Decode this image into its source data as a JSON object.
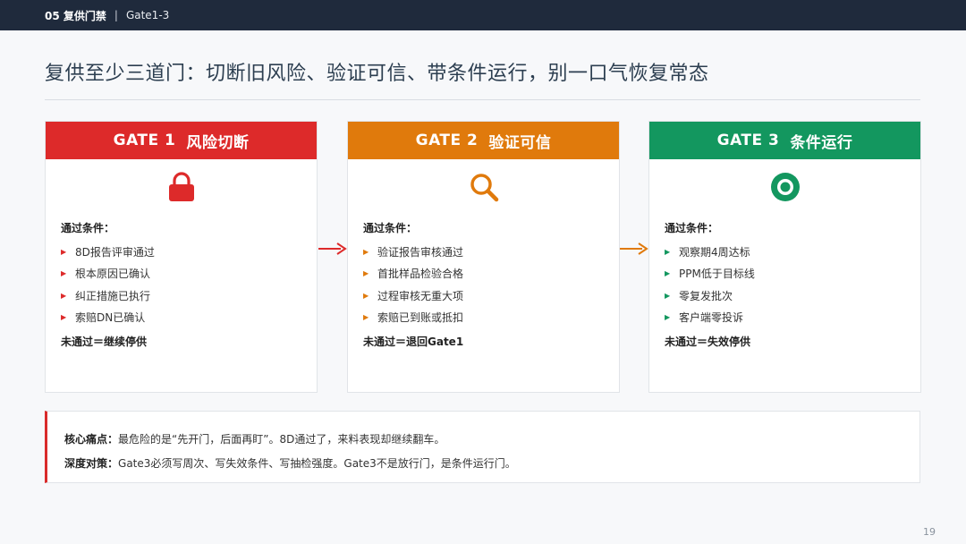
{
  "topbar": {
    "section": "05 复供门禁",
    "separator": "|",
    "subtitle": "Gate1-3"
  },
  "title": "复供至少三道门：切断旧风险、验证可信、带条件运行，别一口气恢复常态",
  "gates": [
    {
      "code": "GATE 1",
      "name": "风险切断",
      "color": "#dd2a2a",
      "icon": "lock-icon",
      "cond_title": "通过条件：",
      "conditions": [
        "8D报告评审通过",
        "根本原因已确认",
        "纠正措施已执行",
        "索赔DN已确认"
      ],
      "fail": "未通过＝继续停供"
    },
    {
      "code": "GATE 2",
      "name": "验证可信",
      "color": "#e07a0c",
      "icon": "magnifier-icon",
      "cond_title": "通过条件：",
      "conditions": [
        "验证报告审核通过",
        "首批样品检验合格",
        "过程审核无重大项",
        "索赔已到账或抵扣"
      ],
      "fail": "未通过＝退回Gate1"
    },
    {
      "code": "GATE 3",
      "name": "条件运行",
      "color": "#13975f",
      "icon": "eye-icon",
      "cond_title": "通过条件：",
      "conditions": [
        "观察期4周达标",
        "PPM低于目标线",
        "零复发批次",
        "客户端零投诉"
      ],
      "fail": "未通过＝失效停供"
    }
  ],
  "pain": {
    "label1": "核心痛点：",
    "text1": "最危险的是“先开门，后面再盯”。8D通过了，来料表现却继续翻车。",
    "label2": "深度对策：",
    "text2": "Gate3必须写周次、写失效条件、写抽检强度。Gate3不是放行门，是条件运行门。",
    "accent": "#d92b2b"
  },
  "page_number": "19"
}
